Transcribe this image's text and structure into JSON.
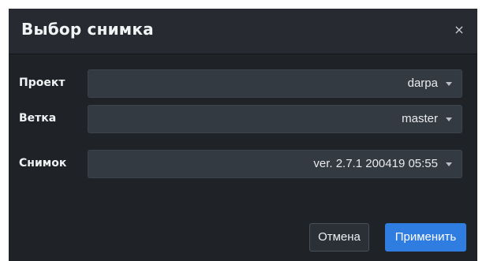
{
  "dialog": {
    "title": "Выбор снимка",
    "close_icon": "close-icon",
    "close_glyph": "×"
  },
  "fields": [
    {
      "label": "Проект",
      "value": "darpa"
    },
    {
      "label": "Ветка",
      "value": "master"
    },
    {
      "label": "Снимок",
      "value": "ver. 2.7.1 200419 05:55"
    }
  ],
  "buttons": {
    "cancel": "Отмена",
    "apply": "Применить"
  },
  "colors": {
    "dialog_bg": "#1f2328",
    "header_bg": "#272b31",
    "select_bg": "#343a42",
    "accent": "#2f7de1"
  }
}
